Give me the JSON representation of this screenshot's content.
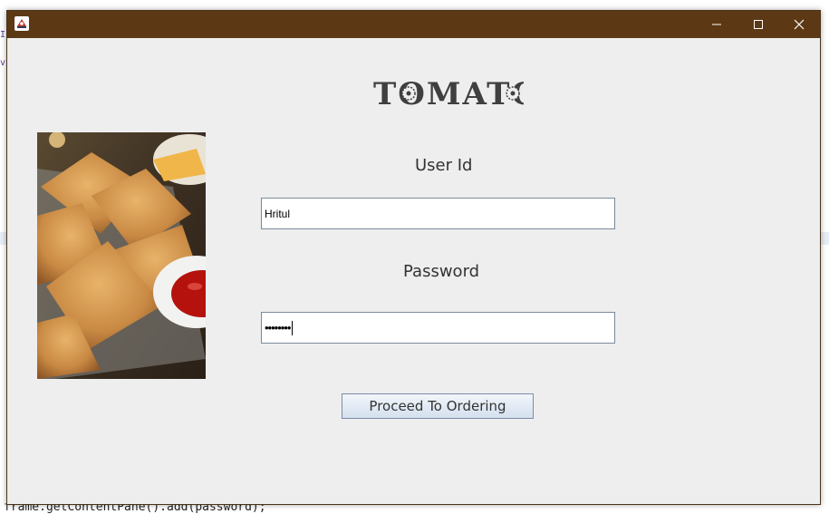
{
  "background_editor": {
    "code_line": "frame.getContentPane().add(password);",
    "gutter_marks": [
      "I",
      "v"
    ]
  },
  "window": {
    "title": "",
    "controls": {
      "minimize_icon": "minimize-icon",
      "maximize_icon": "maximize-icon",
      "close_icon": "close-icon"
    },
    "titlebar_color": "#5c3814"
  },
  "login": {
    "logo_text": "TOMATO",
    "user_label": "User Id",
    "user_value": "Hritul",
    "password_label": "Password",
    "password_masked": "••••••••",
    "submit_label": "Proceed To Ordering"
  },
  "image": {
    "subject": "plate of samosas with ketchup"
  }
}
